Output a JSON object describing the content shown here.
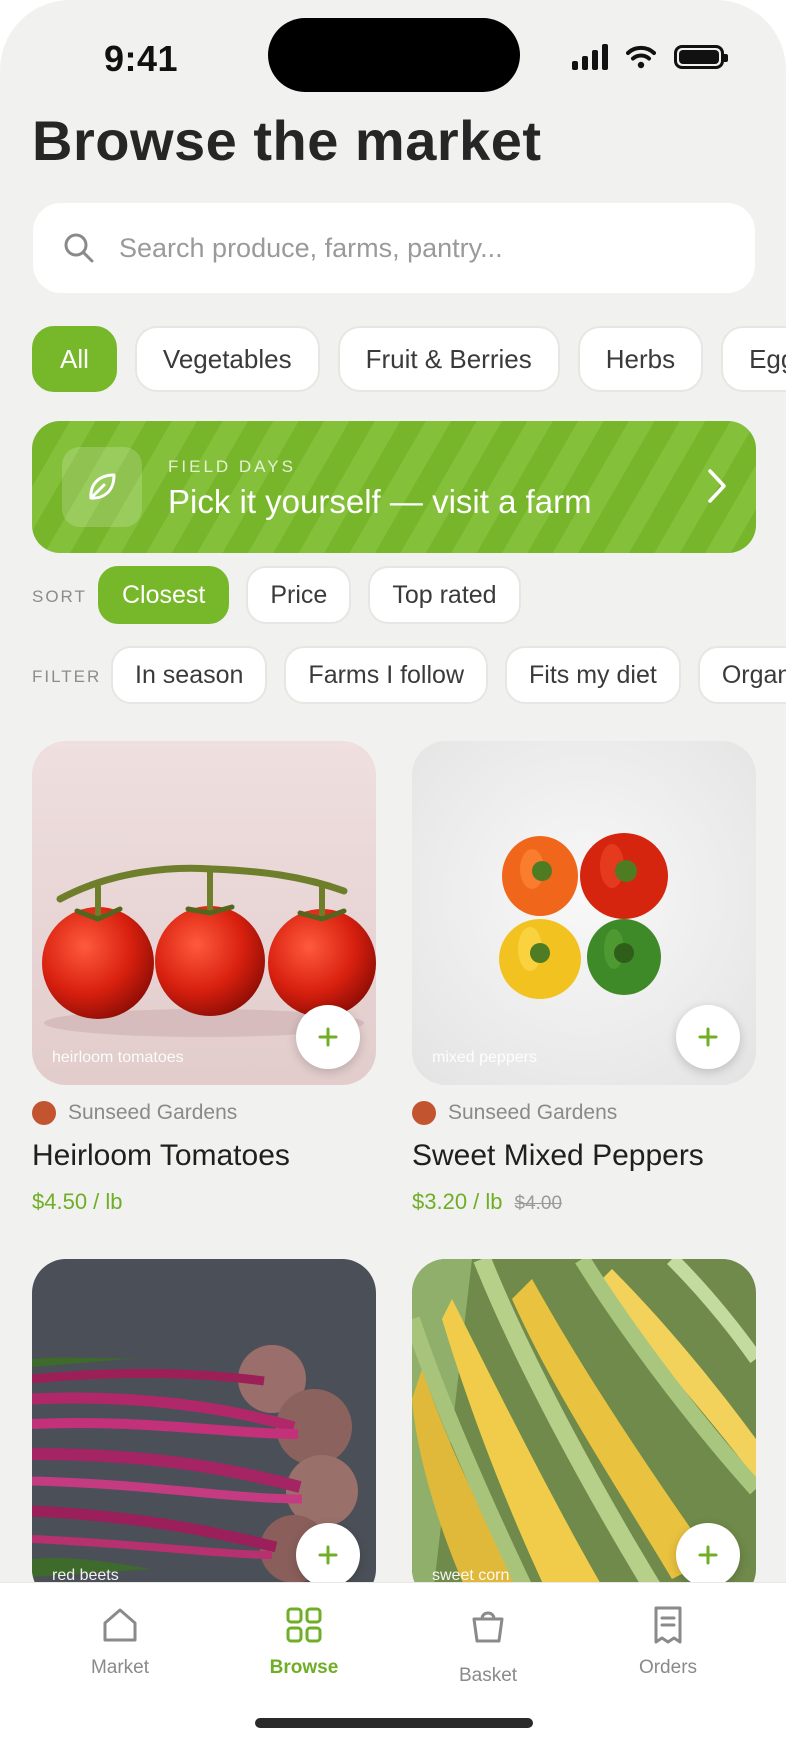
{
  "status_bar": {
    "time": "9:41"
  },
  "header": {
    "title": "Browse the market"
  },
  "search": {
    "placeholder": "Search produce, farms, pantry..."
  },
  "categories": [
    "All",
    "Vegetables",
    "Fruit & Berries",
    "Herbs",
    "Eggs"
  ],
  "banner": {
    "kicker": "FIELD DAYS",
    "title": "Pick it yourself — visit a farm"
  },
  "sort": {
    "label": "SORT",
    "options": [
      "Closest",
      "Price",
      "Top rated"
    ]
  },
  "filter": {
    "label": "FILTER",
    "options": [
      "In season",
      "Farms I follow",
      "Fits my diet",
      "Organic"
    ]
  },
  "products": [
    {
      "caption": "heirloom tomatoes",
      "farm": "Sunseed Gardens",
      "name": "Heirloom Tomatoes",
      "price": "$4.50 / lb",
      "old_price": ""
    },
    {
      "caption": "mixed peppers",
      "farm": "Sunseed Gardens",
      "name": "Sweet Mixed Peppers",
      "price": "$3.20 / lb",
      "old_price": "$4.00"
    },
    {
      "caption": "red beets",
      "farm": "",
      "name": "",
      "price": "",
      "old_price": ""
    },
    {
      "caption": "sweet corn",
      "farm": "",
      "name": "",
      "price": "",
      "old_price": ""
    }
  ],
  "tabbar": {
    "items": [
      {
        "label": "Market",
        "icon": "home-icon"
      },
      {
        "label": "Browse",
        "icon": "grid-icon"
      },
      {
        "label": "Basket",
        "icon": "basket-icon"
      },
      {
        "label": "Orders",
        "icon": "receipt-icon"
      }
    ]
  },
  "colors": {
    "accent": "#76b82a",
    "farm_dot": "#c2542f",
    "background": "#f1f1ef"
  }
}
